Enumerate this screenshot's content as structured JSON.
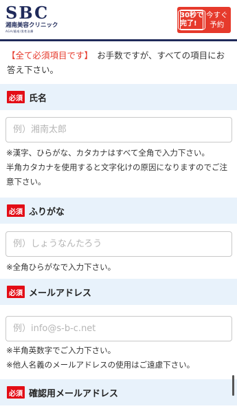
{
  "header": {
    "logo_main": "SBC",
    "logo_sub": "湘南美容クリニック",
    "logo_tiny": "AGA/植毛/男性治療",
    "reserve_badge_line1": "30秒で",
    "reserve_badge_line2": "完了!",
    "reserve_line1": "今すぐ",
    "reserve_line2": "予約",
    "accent_color": "#e63a2c",
    "brand_color": "#1f2a5a"
  },
  "intro": {
    "required_notice": "【全て必須項目です】",
    "text": "　お手数ですが、すべての項目にお答え下さい。"
  },
  "required_badge": "必須",
  "sections": [
    {
      "label": "氏名",
      "placeholder": "例）湘南太郎",
      "value": "",
      "notes": [
        "※漢字、ひらがな、カタカナはすべて全角で入力下さい。",
        "半角カタカナを使用すると文字化けの原因になりますのでご注意下さい。"
      ]
    },
    {
      "label": "ふりがな",
      "placeholder": "例）しょうなんたろう",
      "value": "",
      "notes": [
        "※全角ひらがなで入力下さい。"
      ]
    },
    {
      "label": "メールアドレス",
      "placeholder": "例）info@s-b-c.net",
      "value": "",
      "notes": [
        "※半角英数字でご入力下さい。",
        "※他人名義のメールアドレスの使用はご遠慮下さい。"
      ]
    },
    {
      "label": "確認用メールアドレス"
    }
  ]
}
